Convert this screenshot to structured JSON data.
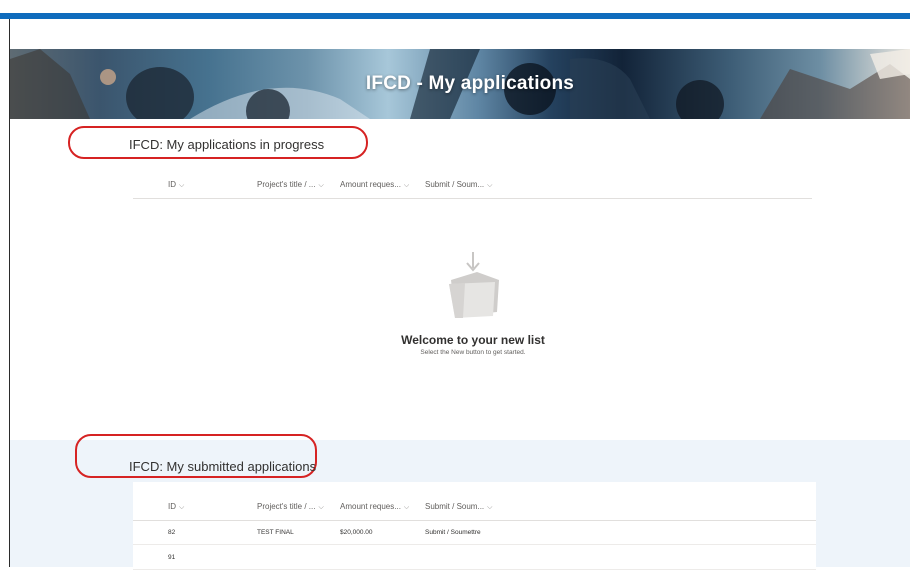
{
  "banner": {
    "title": "IFCD - My applications"
  },
  "sections": [
    {
      "title": "IFCD: My applications in progress",
      "columns": [
        "ID",
        "Project's title / ...",
        "Amount reques...",
        "Submit / Soum..."
      ],
      "empty_state": {
        "title": "Welcome to your new list",
        "subtitle": "Select the New button to get started."
      }
    },
    {
      "title": "IFCD: My submitted applications",
      "columns": [
        "ID",
        "Project's title / ...",
        "Amount reques...",
        "Submit / Soum..."
      ],
      "rows": [
        {
          "id": "82",
          "title": "TEST FINAL",
          "amount": "$20,000.00",
          "submit": "Submit / Soumettre"
        },
        {
          "id": "91",
          "title": "",
          "amount": "",
          "submit": ""
        }
      ]
    }
  ],
  "icons": {
    "sort": "chevron-down-icon",
    "empty_list": "folder-with-arrow-icon"
  },
  "colors": {
    "top_bar": "#0f6cbd",
    "highlight": "#d62323",
    "section_bg": "#eef4fa"
  }
}
